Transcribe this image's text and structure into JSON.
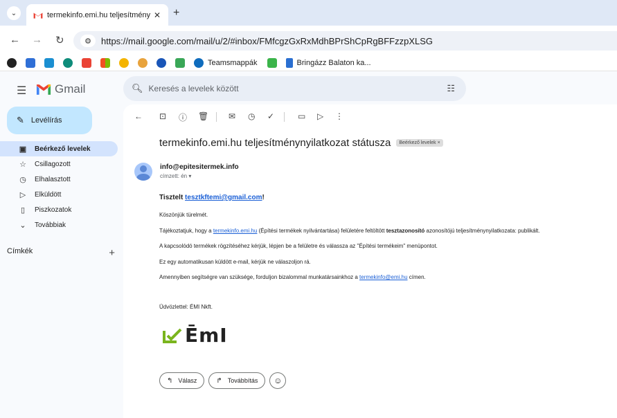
{
  "browser": {
    "tab_title": "termekinfo.emi.hu teljesítmény",
    "url_host": "https://mail.google.com",
    "url_path": "/mail/u/2/#inbox/FMfcgzGxRxMdhBPrShCpRgBFFzzpXLSG",
    "bookmarks": [
      {
        "label": "Teamsmappák"
      },
      {
        "label": "Bringázz Balaton ka..."
      }
    ]
  },
  "gmail": {
    "logo_text": "Gmail",
    "search_placeholder": "Keresés a levelek között",
    "compose_label": "Levélírás",
    "nav": [
      {
        "label": "Beérkező levelek",
        "icon": "inbox-icon",
        "active": true
      },
      {
        "label": "Csillagozott",
        "icon": "star-icon"
      },
      {
        "label": "Elhalasztott",
        "icon": "clock-icon"
      },
      {
        "label": "Elküldött",
        "icon": "send-icon"
      },
      {
        "label": "Piszkozatok",
        "icon": "draft-icon"
      },
      {
        "label": "Továbbiak",
        "icon": "chevron-down-icon"
      }
    ],
    "labels_header": "Címkék"
  },
  "email": {
    "subject": "termekinfo.emi.hu teljesítménynyilatkozat státusza",
    "label_chip": "Beérkező levelek ×",
    "sender": "info@epitesitermek.info",
    "recipient": "címzett: én ▾",
    "greeting_prefix": "Tisztelt ",
    "greeting_link": "tesztkftemi@gmail.com",
    "greeting_suffix": "!",
    "line1": "Köszönjük türelmét.",
    "line2_a": "Tájékoztatjuk, hogy a ",
    "line2_link": "termekinfo.emi.hu",
    "line2_b": " (Építési termékek nyilvántartása) felületére feltöltött ",
    "line2_bold": "tesztazonosító",
    "line2_c": " azonosítójú teljesítménynyilatkozata: publikált.",
    "line3": "A kapcsolódó termékek rögzítéséhez kérjük, lépjen be a felületre és válassza az \"Építési termékeim\" menüpontot.",
    "line4": "Ez egy automatikusan küldött e-mail, kérjük ne válaszoljon rá.",
    "line5_a": "Amennyiben segítségre van szüksége, forduljon bizalommal munkatársainkhoz a ",
    "line5_link": "termekinfo@emi.hu",
    "line5_b": " címen.",
    "signoff": "Üdvözlettel: ÉMI Nkft.",
    "logo_text": "ĒmI",
    "reply_label": "Válasz",
    "forward_label": "Továbbítás"
  },
  "colors": {
    "accent": "#1a5fd6",
    "compose_bg": "#c2e7ff",
    "active_nav": "#d3e3fd",
    "logo_green": "#7ab51d"
  }
}
